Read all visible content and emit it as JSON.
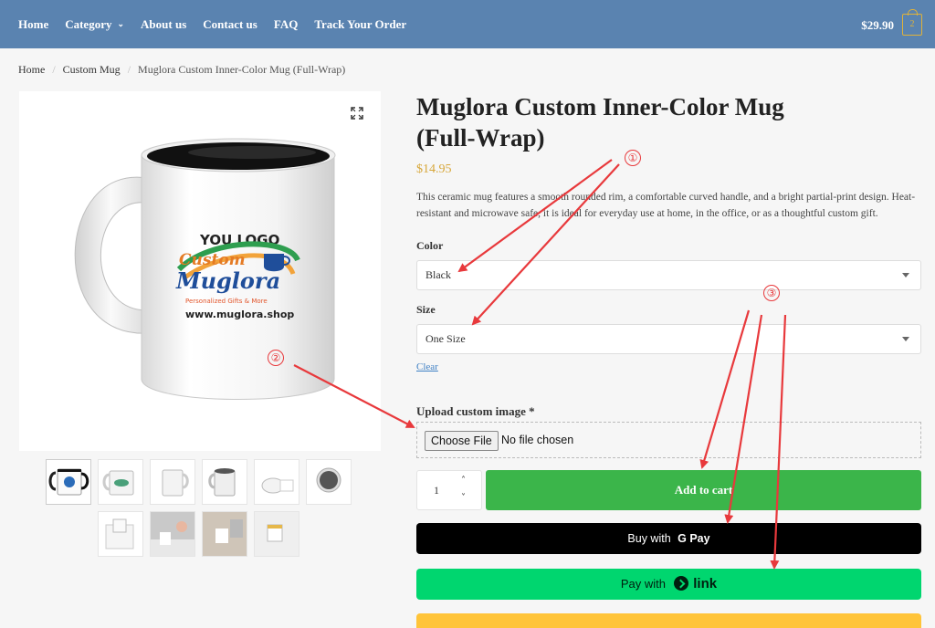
{
  "header": {
    "nav": [
      {
        "label": "Home"
      },
      {
        "label": "Category",
        "has_dropdown": true
      },
      {
        "label": "About us"
      },
      {
        "label": "Contact us"
      },
      {
        "label": "FAQ"
      },
      {
        "label": "Track Your Order"
      }
    ],
    "cart_total": "$29.90",
    "cart_count": "2"
  },
  "breadcrumb": {
    "items": [
      "Home",
      "Custom Mug"
    ],
    "current": "Muglora Custom Inner-Color Mug (Full-Wrap)"
  },
  "gallery": {
    "main_image": {
      "logo_top": "YOU LOGO",
      "logo_custom": "Custom",
      "logo_brand": "Muglora",
      "logo_tagline": "Personalized Gifts & More",
      "logo_url": "www.muglora.shop"
    },
    "thumbnail_count": 10
  },
  "product": {
    "title": "Muglora Custom Inner-Color Mug (Full-Wrap)",
    "price": "$14.95",
    "description": "This ceramic mug features a smooth rounded rim, a comfortable curved handle, and a bright partial-print design. Heat-resistant and microwave safe, it is ideal for everyday use at home, in the office, or as a thoughtful custom gift.",
    "color_label": "Color",
    "color_value": "Black",
    "size_label": "Size",
    "size_value": "One Size",
    "clear_label": "Clear",
    "upload_label": "Upload custom image *",
    "choose_file_label": "Choose File",
    "file_status": "No file chosen",
    "quantity": "1",
    "add_to_cart_label": "Add to cart",
    "gpay_prefix": "Buy with",
    "gpay_brand": "G Pay",
    "link_prefix": "Pay with",
    "link_brand": "link"
  },
  "annotations": [
    "①",
    "②",
    "③"
  ],
  "colors": {
    "header_bg": "#5a83b0",
    "price": "#d7a73a",
    "add_to_cart": "#3bb54a",
    "link_button": "#00d66f",
    "paypal_button": "#ffc439",
    "annotation": "#e8393c"
  }
}
